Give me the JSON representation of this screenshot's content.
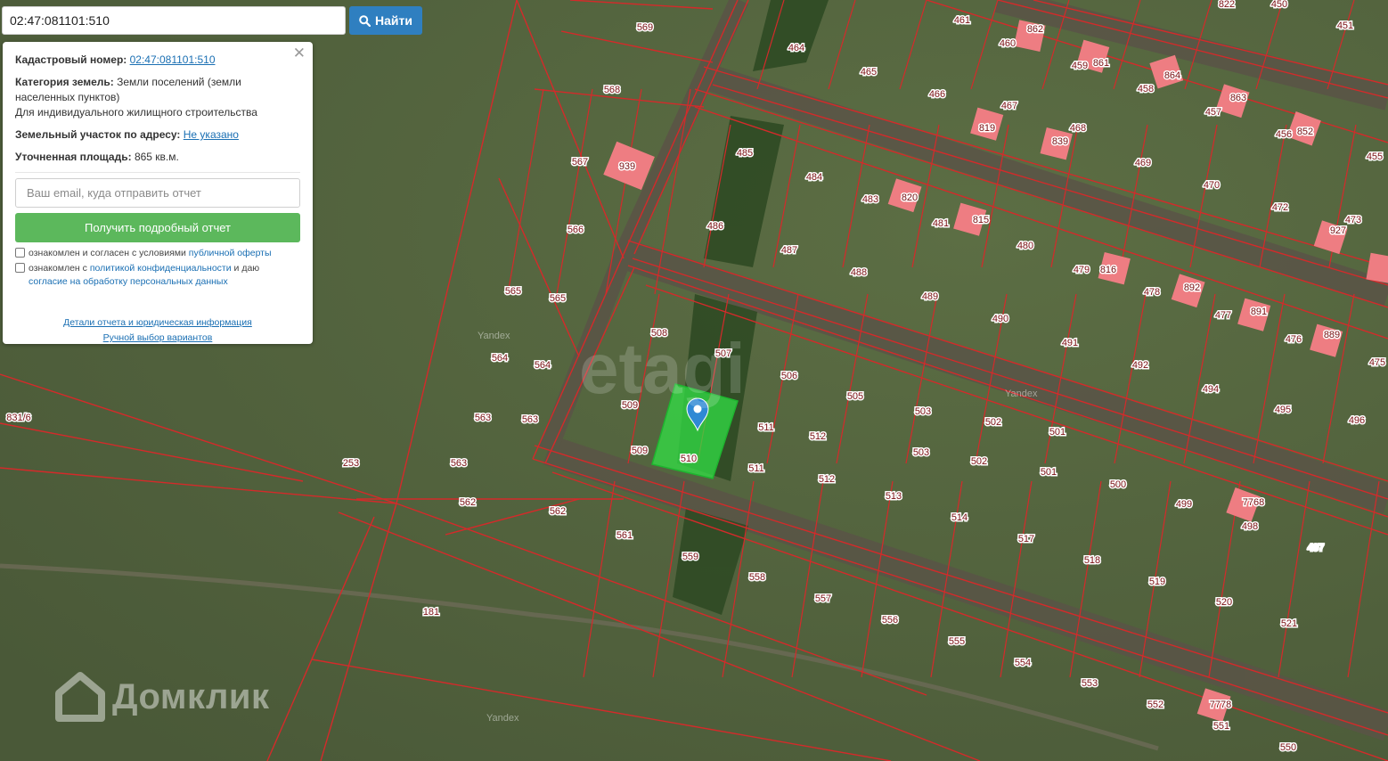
{
  "search": {
    "value": "02:47:081101:510",
    "button_label": "Найти"
  },
  "info_panel": {
    "cadastral_label": "Кадастровый номер:",
    "cadastral_value": "02:47:081101:510",
    "category_label": "Категория земель:",
    "category_value": "Земли поселений (земли населенных пунктов)",
    "usage": "Для индивидуального жилищного строительства",
    "address_label": "Земельный участок по адресу:",
    "address_value": "Не указано",
    "area_label": "Уточненная площадь:",
    "area_value": "865 кв.м.",
    "email_placeholder": "Ваш email, куда отправить отчет",
    "report_button": "Получить подробный отчет",
    "consent1_text": "ознакомлен и согласен с условиями",
    "consent1_link": "публичной оферты",
    "consent2_text_a": "ознакомлен с",
    "consent2_link_a": "политикой конфиденциальности",
    "consent2_text_b": "и даю",
    "consent2_link_b": "согласие на обработку персональных данных",
    "details_link": "Детали отчета и юридическая информация",
    "manual_link": "Ручной выбор вариантов"
  },
  "watermarks": {
    "domclick": "Домклик",
    "etagi": "etagi",
    "yandex": "Yandex"
  },
  "colors": {
    "parcel_border": "#d42a2a",
    "building_fill": "#ee7d82",
    "selected_parcel": "#32e046",
    "search_button": "#2f7fc0",
    "report_button": "#5cb85c",
    "marker": "#2f89d4"
  },
  "map_labels": {
    "parcels": [
      "451",
      "461",
      "822",
      "450",
      "569",
      "464",
      "465",
      "466",
      "460",
      "862",
      "459",
      "861",
      "458",
      "864",
      "457",
      "863",
      "456",
      "852",
      "455",
      "568",
      "567",
      "939",
      "485",
      "484",
      "467",
      "819",
      "468",
      "839",
      "469",
      "470",
      "472",
      "473",
      "927",
      "566",
      "486",
      "487",
      "483",
      "820",
      "481",
      "815",
      "480",
      "479",
      "816",
      "478",
      "892",
      "477",
      "891",
      "476",
      "889",
      "475",
      "565",
      "565",
      "488",
      "489",
      "490",
      "491",
      "492",
      "494",
      "495",
      "496",
      "564",
      "564",
      "508",
      "507",
      "506",
      "505",
      "503",
      "502",
      "501",
      "500",
      "499",
      "498",
      "7768",
      "497",
      "509",
      "509",
      "510",
      "511",
      "511",
      "512",
      "512",
      "503",
      "502",
      "501",
      "563",
      "563",
      "563",
      "831/6",
      "253",
      "562",
      "562",
      "561",
      "559",
      "558",
      "513",
      "514",
      "517",
      "518",
      "519",
      "520",
      "521",
      "557",
      "556",
      "555",
      "554",
      "553",
      "552",
      "7778",
      "551",
      "550",
      "181"
    ],
    "selected_parcel_label": "510"
  }
}
